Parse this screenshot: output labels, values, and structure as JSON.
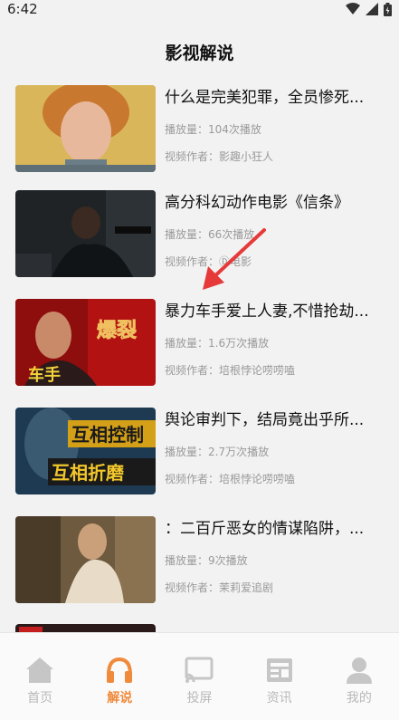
{
  "status_bar": {
    "time": "6:42"
  },
  "page_title": "影视解说",
  "items": [
    {
      "title": "什么是完美犯罪，全员惨死...",
      "plays": "播放量：104次播放",
      "author": "视频作者：影趣小狂人"
    },
    {
      "title": "高分科幻动作电影《信条》",
      "plays": "播放量：66次播放",
      "author": "视频作者：Ⓓ电影"
    },
    {
      "title": "暴力车手爱上人妻,不惜抢劫...",
      "plays": "播放量：1.6万次播放",
      "author": "视频作者：培根悖论唠唠嗑",
      "thumb_text_1": "爆裂",
      "thumb_text_2": "车手"
    },
    {
      "title": "舆论审判下，结局竟出乎所...",
      "plays": "播放量：2.7万次播放",
      "author": "视频作者：培根悖论唠唠嗑",
      "thumb_text_1": "互相控制",
      "thumb_text_2": "互相折磨"
    },
    {
      "title": "：二百斤恶女的情谋陷阱，...",
      "plays": "播放量：9次播放",
      "author": "视频作者：茉莉爱追剧"
    }
  ],
  "nav": [
    {
      "label": "首页",
      "icon": "home-icon"
    },
    {
      "label": "解说",
      "icon": "headphones-icon"
    },
    {
      "label": "投屏",
      "icon": "cast-icon"
    },
    {
      "label": "资讯",
      "icon": "news-icon"
    },
    {
      "label": "我的",
      "icon": "person-icon"
    }
  ],
  "colors": {
    "accent": "#f08a3c",
    "inactive": "#b9b9b9"
  }
}
